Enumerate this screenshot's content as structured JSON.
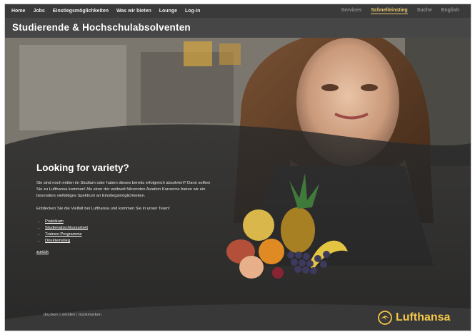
{
  "nav": {
    "left": [
      "Home",
      "Jobs",
      "Einstiegsmöglichkeiten",
      "Was wir bieten",
      "Lounge",
      "Log-in"
    ],
    "right": [
      "Services",
      "Schnelleinstieg",
      "Suche",
      "English"
    ],
    "active": "Schnelleinstieg"
  },
  "header": {
    "title": "Studierende & Hochschulabsolventen"
  },
  "main": {
    "heading": "Looking for variety?",
    "para1": "Sie sind noch mitten im Studium oder haben dieses bereits erfolgreich absolviert? Dann sollten Sie zu Lufthansa kommen! Als einer der weltweit führenden Aviation Konzerne bieten wir ein besonders vielfältiges Spektrum an Einstiegsmöglichkeiten.",
    "para2": "Entdecken Sie die Vielfalt bei Lufthansa und kommen Sie in unser Team!",
    "links": [
      "Praktikum",
      "Studienabschlussarbeit",
      "Trainee-Programme",
      "Direkteinstieg"
    ],
    "back": "zurück"
  },
  "footer": {
    "links": "drucken | senden | bookmarken"
  },
  "brand": {
    "name": "Lufthansa",
    "color": "#f4c64a",
    "icon": "crane-logo-icon"
  }
}
